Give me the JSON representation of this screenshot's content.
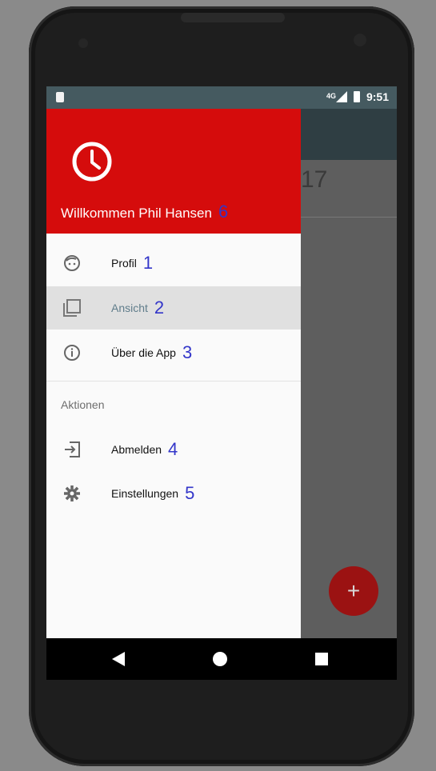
{
  "status_bar": {
    "network": "4G",
    "time": "9:51"
  },
  "app": {
    "date_fragment": "17",
    "fab_label": "+"
  },
  "drawer": {
    "welcome": "Willkommen Phil Hansen",
    "welcome_marker": "6",
    "items": [
      {
        "label": "Profil",
        "marker": "1",
        "icon": "face-icon"
      },
      {
        "label": "Ansicht",
        "marker": "2",
        "icon": "view-icon",
        "active": true
      },
      {
        "label": "Über die App",
        "marker": "3",
        "icon": "info-icon"
      }
    ],
    "section_title": "Aktionen",
    "actions": [
      {
        "label": "Abmelden",
        "marker": "4",
        "icon": "logout-icon"
      },
      {
        "label": "Einstellungen",
        "marker": "5",
        "icon": "gear-icon"
      }
    ]
  },
  "colors": {
    "header": "#d50c0c",
    "active_text": "#607d8b",
    "annotation": "#3336c9"
  }
}
